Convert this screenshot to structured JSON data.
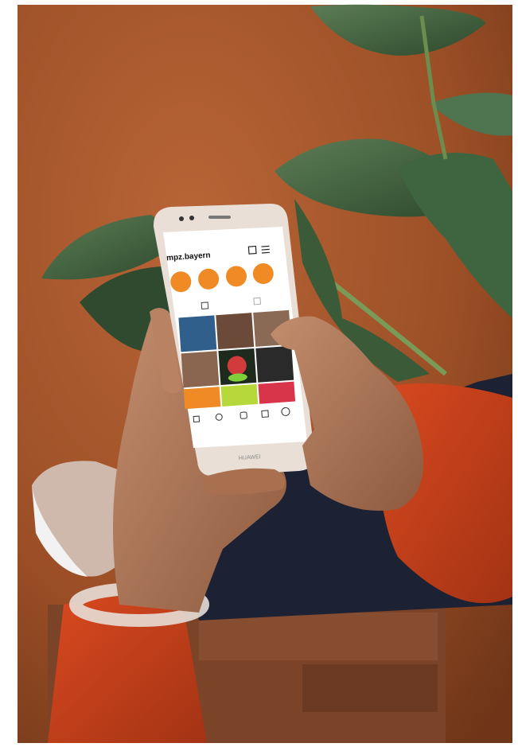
{
  "photo": {
    "subject": "hands holding a smartphone showing a social media profile"
  },
  "phone": {
    "brand": "HUAWEI",
    "screen": {
      "username": "mpz.bayern",
      "highlights": [
        {
          "label": ""
        },
        {
          "label": ""
        },
        {
          "label": ""
        },
        {
          "label": ""
        }
      ]
    }
  },
  "colors": {
    "floor": "#a9582c",
    "sleeve": "#c8401b",
    "highlight_orange": "#f08a24",
    "phone_frame": "#e9dfd6",
    "leaf": "#3c5e3a",
    "skin": "#b07a5a"
  }
}
